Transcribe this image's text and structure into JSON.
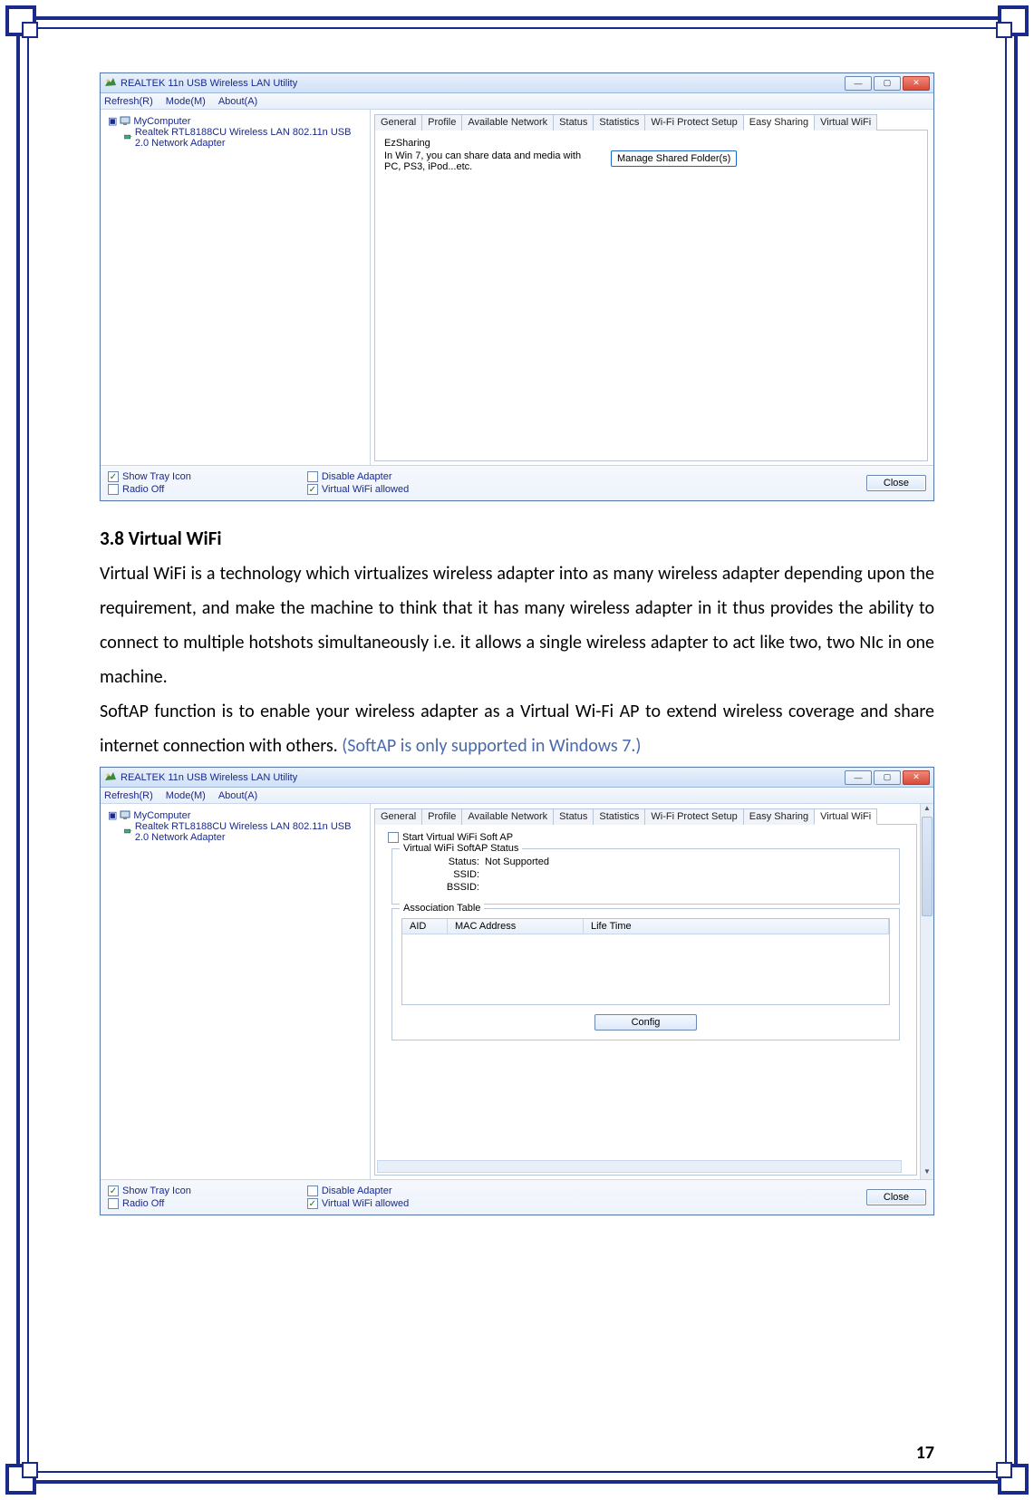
{
  "page_number": "17",
  "app_title": "REALTEK 11n USB Wireless LAN Utility",
  "menus": {
    "refresh": "Refresh(R)",
    "mode": "Mode(M)",
    "about": "About(A)"
  },
  "tree": {
    "root": "MyComputer",
    "child": "Realtek RTL8188CU Wireless LAN 802.11n USB 2.0 Network Adapter"
  },
  "tabs": {
    "general": "General",
    "profile": "Profile",
    "available_network": "Available Network",
    "status": "Status",
    "statistics": "Statistics",
    "wifi_protect": "Wi-Fi Protect Setup",
    "easy_sharing": "Easy Sharing",
    "virtual_wifi": "Virtual WiFi"
  },
  "easy_sharing_panel": {
    "heading": "EzSharing",
    "desc": "In Win 7, you can share data and media with PC, PS3, iPod...etc.",
    "manage_btn": "Manage Shared Folder(s)"
  },
  "checkboxes": {
    "show_tray": "Show Tray Icon",
    "radio_off": "Radio Off",
    "disable_adapter": "Disable Adapter",
    "virtual_wifi_allowed": "Virtual WiFi allowed"
  },
  "close_label": "Close",
  "section": {
    "number_title": "3.8   Virtual WiFi",
    "p1": "Virtual WiFi is a technology which virtualizes wireless adapter into as many wireless adapter depending upon the requirement, and make the machine to think that it has many wireless adapter in it thus provides the ability to connect to multiple hotshots simultaneously i.e. it allows a single wireless adapter to act like two, two NIc in one machine.",
    "p2a": "SoftAP function is to enable your wireless adapter as a Virtual Wi-Fi AP to extend wireless coverage and share internet connection with others. ",
    "p2b": "(SoftAP is only supported in Windows 7.)"
  },
  "virtual_wifi_panel": {
    "start_checkbox": "Start Virtual WiFi Soft AP",
    "group_title": "Virtual WiFi SoftAP Status",
    "status_label": "Status:",
    "status_value": "Not Supported",
    "ssid_label": "SSID:",
    "bssid_label": "BSSID:",
    "assoc_title": "Association Table",
    "col_aid": "AID",
    "col_mac": "MAC Address",
    "col_life": "Life Time",
    "config_btn": "Config"
  }
}
